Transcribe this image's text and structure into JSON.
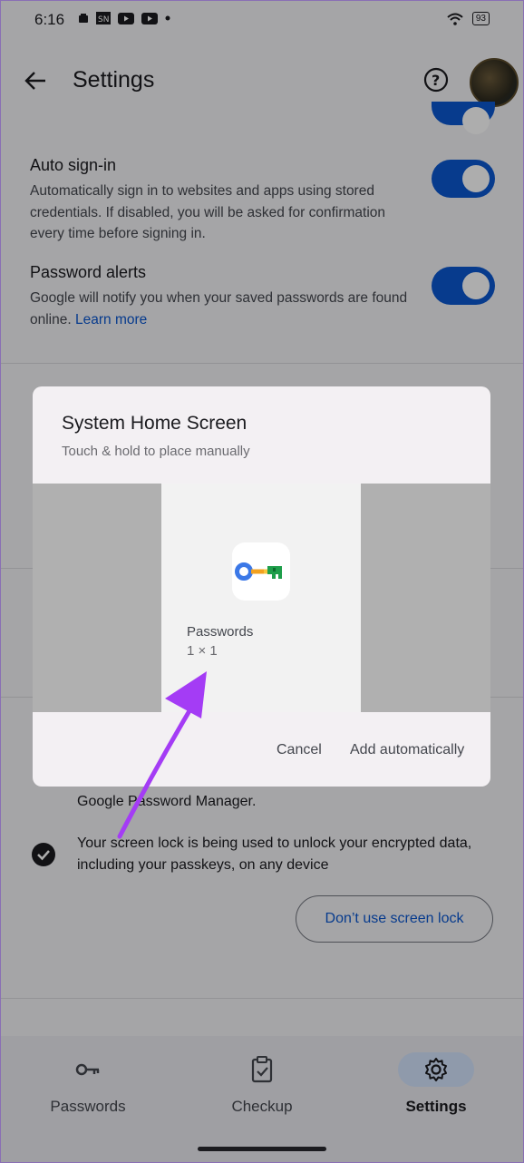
{
  "status_bar": {
    "time": "6:16",
    "battery": "93"
  },
  "app_bar": {
    "title": "Settings"
  },
  "settings": [
    {
      "title": "Auto sign-in",
      "description": "Automatically sign in to websites and apps using stored credentials. If disabled, you will be asked for confirmation every time before signing in.",
      "enabled": true
    },
    {
      "title": "Password alerts",
      "description": "Google will notify you when your saved passwords are found online.",
      "link": "Learn more",
      "enabled": true
    }
  ],
  "background_text": {
    "partial_line": "Google Password Manager.",
    "screen_lock_text": "Your screen lock is being used to unlock your encrypted data, including your passkeys, on any device",
    "screen_lock_button": "Don’t use screen lock"
  },
  "dialog": {
    "title": "System Home Screen",
    "subtitle": "Touch & hold to place manually",
    "widget_name": "Passwords",
    "widget_size": "1 × 1",
    "cancel": "Cancel",
    "add": "Add automatically"
  },
  "bottom_nav": [
    {
      "label": "Passwords",
      "icon": "key-icon",
      "active": false
    },
    {
      "label": "Checkup",
      "icon": "clipboard-check-icon",
      "active": false
    },
    {
      "label": "Settings",
      "icon": "gear-icon",
      "active": true
    }
  ],
  "colors": {
    "accent": "#0b57d0",
    "annotation_arrow": "#a43cf5"
  }
}
